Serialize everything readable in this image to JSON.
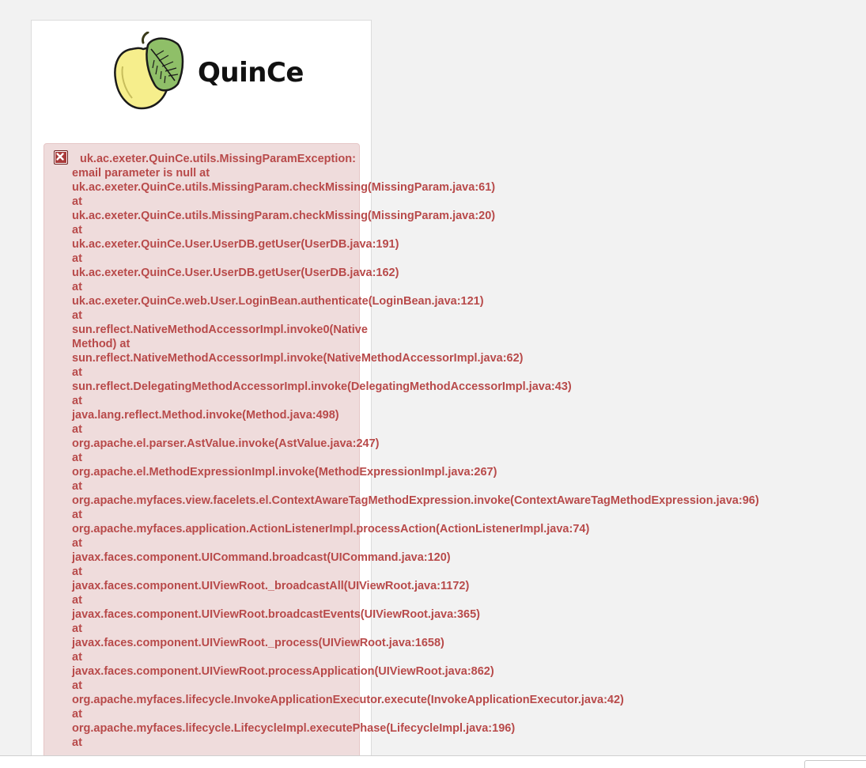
{
  "brand": {
    "name": "QuinCe",
    "logo_icon": "quince-fruit-logo"
  },
  "error": {
    "icon": "error-close-icon",
    "lines": [
      "uk.ac.exeter.QuinCe.utils.MissingParamException:",
      "email parameter is null at",
      "uk.ac.exeter.QuinCe.utils.MissingParam.checkMissing(MissingParam.java:61)",
      "at",
      "uk.ac.exeter.QuinCe.utils.MissingParam.checkMissing(MissingParam.java:20)",
      "at",
      "uk.ac.exeter.QuinCe.User.UserDB.getUser(UserDB.java:191)",
      "at",
      "uk.ac.exeter.QuinCe.User.UserDB.getUser(UserDB.java:162)",
      "at",
      "uk.ac.exeter.QuinCe.web.User.LoginBean.authenticate(LoginBean.java:121)",
      "at",
      "sun.reflect.NativeMethodAccessorImpl.invoke0(Native",
      "Method) at",
      "sun.reflect.NativeMethodAccessorImpl.invoke(NativeMethodAccessorImpl.java:62)",
      "at",
      "sun.reflect.DelegatingMethodAccessorImpl.invoke(DelegatingMethodAccessorImpl.java:43)",
      "at",
      "java.lang.reflect.Method.invoke(Method.java:498)",
      "at",
      "org.apache.el.parser.AstValue.invoke(AstValue.java:247)",
      "at",
      "org.apache.el.MethodExpressionImpl.invoke(MethodExpressionImpl.java:267)",
      "at",
      "org.apache.myfaces.view.facelets.el.ContextAwareTagMethodExpression.invoke(ContextAwareTagMethodExpression.java:96)",
      "at",
      "org.apache.myfaces.application.ActionListenerImpl.processAction(ActionListenerImpl.java:74)",
      "at",
      "javax.faces.component.UICommand.broadcast(UICommand.java:120)",
      "at",
      "javax.faces.component.UIViewRoot._broadcastAll(UIViewRoot.java:1172)",
      "at",
      "javax.faces.component.UIViewRoot.broadcastEvents(UIViewRoot.java:365)",
      "at",
      "javax.faces.component.UIViewRoot._process(UIViewRoot.java:1658)",
      "at",
      "javax.faces.component.UIViewRoot.processApplication(UIViewRoot.java:862)",
      "at",
      "org.apache.myfaces.lifecycle.InvokeApplicationExecutor.execute(InvokeApplicationExecutor.java:42)",
      "at",
      "org.apache.myfaces.lifecycle.LifecycleImpl.executePhase(LifecycleImpl.java:196)",
      "at"
    ]
  },
  "colors": {
    "error_text": "#b84a4a",
    "error_background": "#efdcdc",
    "panel_background": "#ffffff",
    "page_background": "#f2f2f2"
  }
}
